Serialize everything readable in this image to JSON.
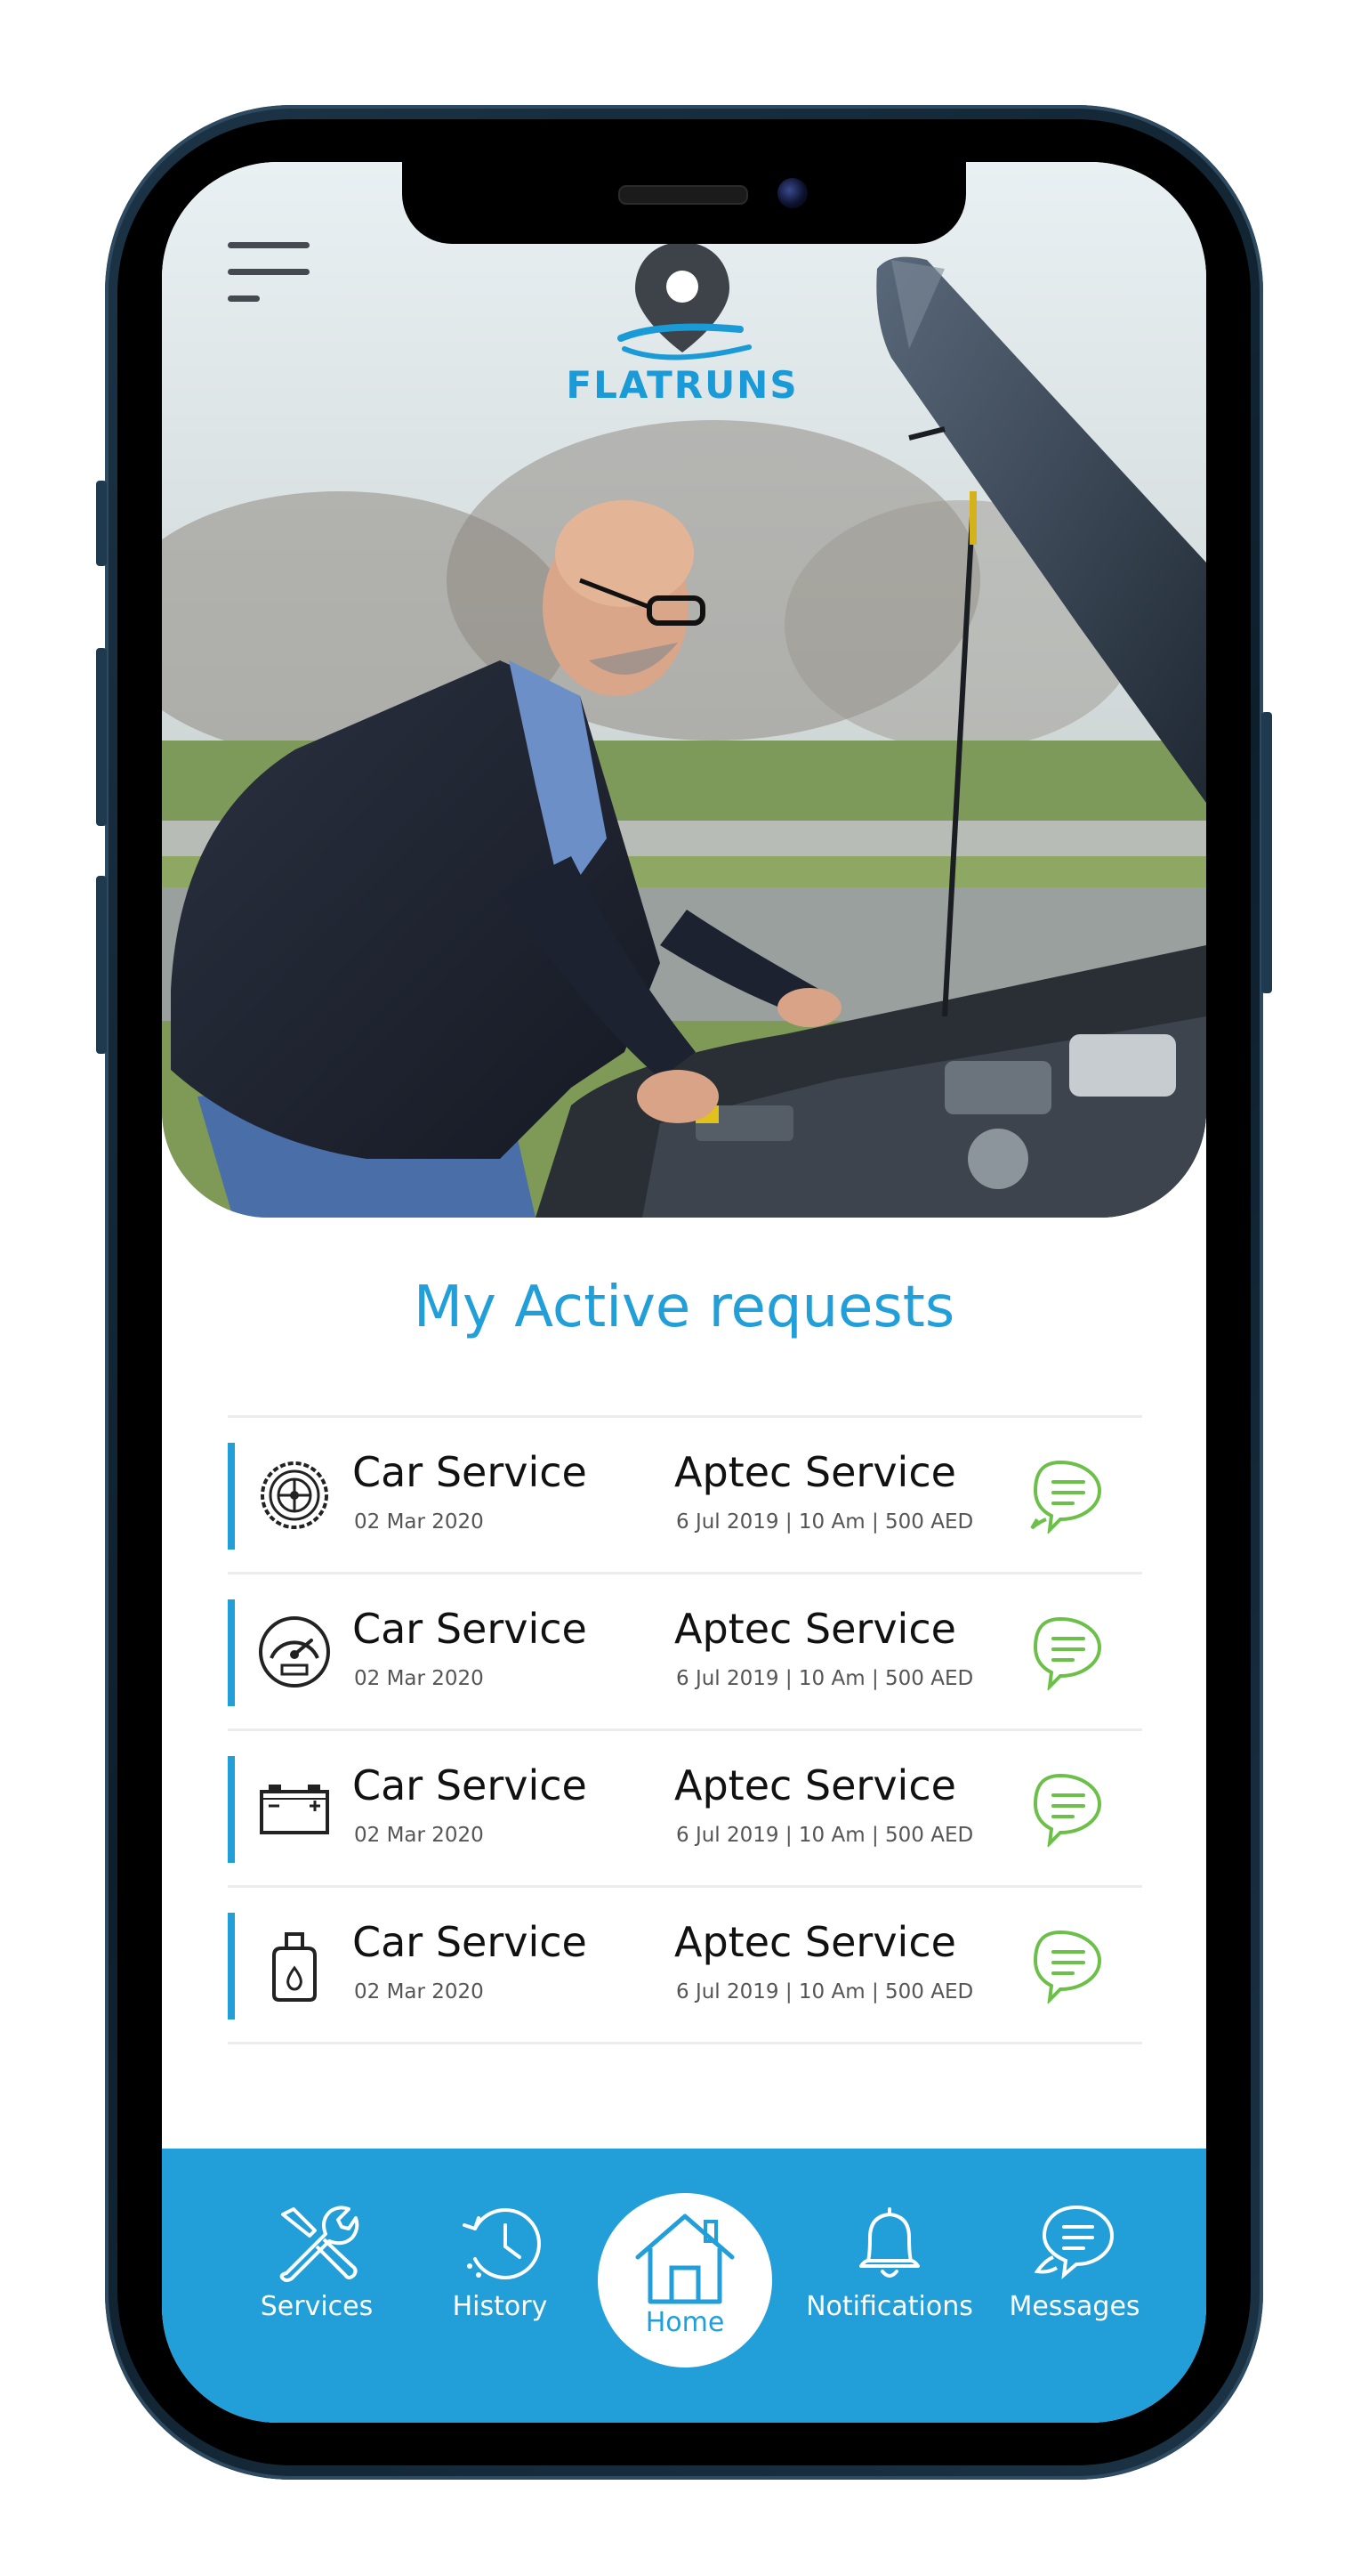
{
  "app": {
    "brand": "FLATRUNS"
  },
  "main": {
    "section_title": "My Active requests",
    "requests": [
      {
        "icon": "tire-icon",
        "service": "Car Service",
        "date": "02 Mar 2020",
        "provider": "Aptec Service",
        "details": "6 Jul 2019 | 10 Am | 500 AED"
      },
      {
        "icon": "gauge-icon",
        "service": "Car Service",
        "date": "02 Mar 2020",
        "provider": "Aptec Service",
        "details": "6 Jul 2019 | 10 Am | 500 AED"
      },
      {
        "icon": "battery-icon",
        "service": "Car Service",
        "date": "02 Mar 2020",
        "provider": "Aptec Service",
        "details": "6 Jul 2019 | 10 Am | 500 AED"
      },
      {
        "icon": "oil-can-icon",
        "service": "Car Service",
        "date": "02 Mar 2020",
        "provider": "Aptec Service",
        "details": "6 Jul 2019 | 10 Am | 500 AED"
      }
    ]
  },
  "nav": {
    "items": [
      {
        "label": "Services",
        "icon": "wrench-icon"
      },
      {
        "label": "History",
        "icon": "history-icon"
      },
      {
        "label": "Home",
        "icon": "home-icon",
        "active": true
      },
      {
        "label": "Notifications",
        "icon": "bell-icon"
      },
      {
        "label": "Messages",
        "icon": "chat-icon"
      }
    ]
  },
  "colors": {
    "accent": "#229fd8",
    "chat_icon": "#6cc04a",
    "divider": "#ececec"
  }
}
